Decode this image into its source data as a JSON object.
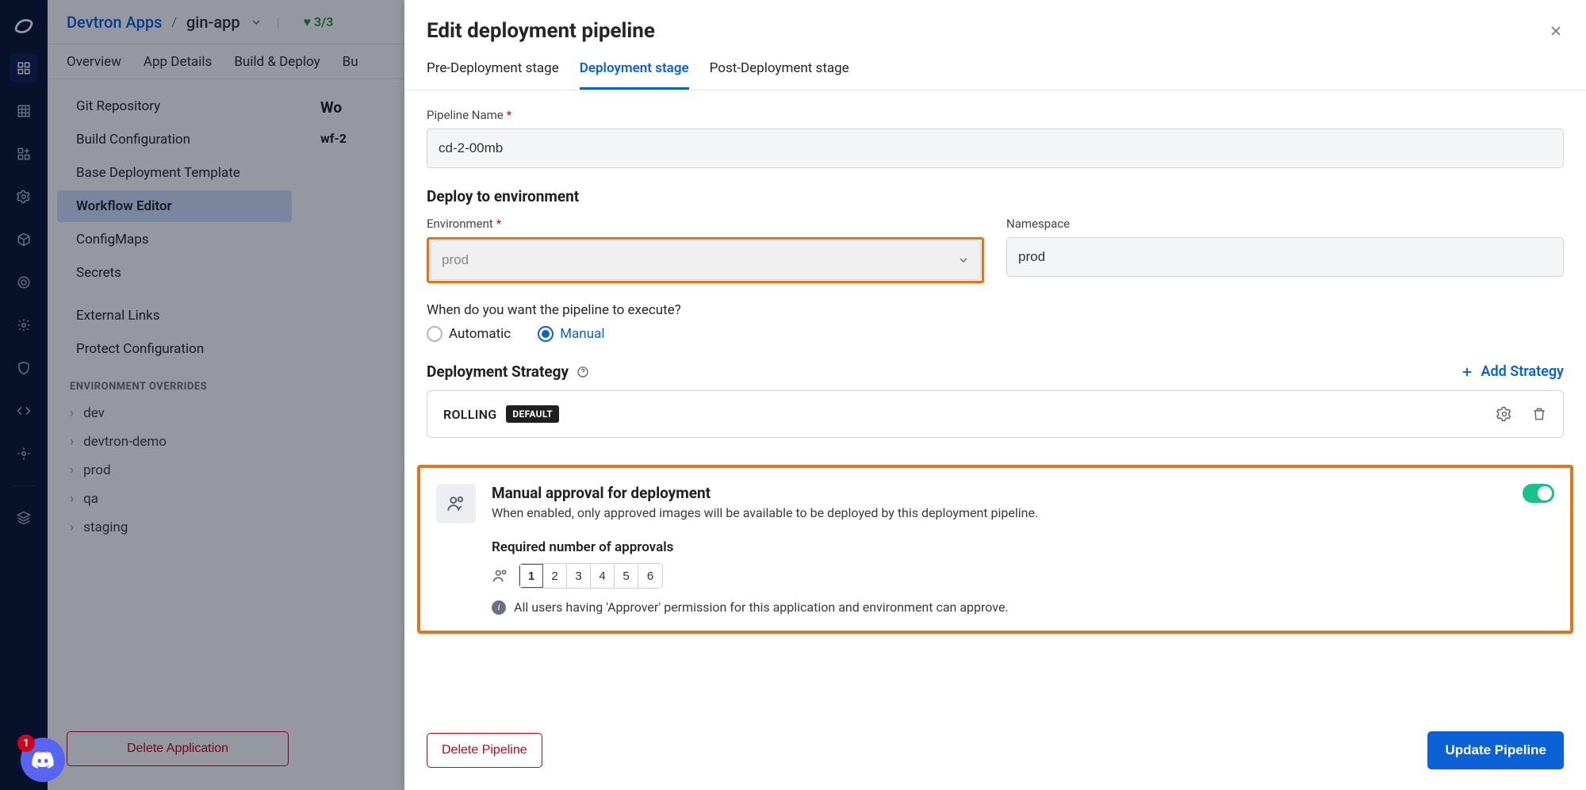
{
  "breadcrumb": {
    "root": "Devtron Apps",
    "app": "gin-app",
    "status": "3/3"
  },
  "top_tabs": [
    "Overview",
    "App Details",
    "Build & Deploy",
    "Bu"
  ],
  "sidepanel": {
    "items": [
      "Git Repository",
      "Build Configuration",
      "Base Deployment Template",
      "Workflow Editor",
      "ConfigMaps",
      "Secrets",
      "External Links",
      "Protect Configuration"
    ],
    "selected": "Workflow Editor",
    "env_heading": "ENVIRONMENT OVERRIDES",
    "envs": [
      "dev",
      "devtron-demo",
      "prod",
      "qa",
      "staging"
    ]
  },
  "main": {
    "workflows_heading": "Wo",
    "wf_name": "wf-2"
  },
  "delete_app_label": "Delete Application",
  "discord_badge": "1",
  "drawer": {
    "title": "Edit deployment pipeline",
    "tabs": [
      "Pre-Deployment stage",
      "Deployment stage",
      "Post-Deployment stage"
    ],
    "active_tab": "Deployment stage",
    "pipeline_name_label": "Pipeline Name",
    "pipeline_name": "cd-2-00mb",
    "deploy_to_env": "Deploy to environment",
    "env_label": "Environment",
    "env_value": "prod",
    "namespace_label": "Namespace",
    "namespace_value": "prod",
    "exec_question": "When do you want the pipeline to execute?",
    "exec_options": {
      "automatic": "Automatic",
      "manual": "Manual"
    },
    "strategy_label": "Deployment Strategy",
    "add_strategy": "Add Strategy",
    "strategy_item": {
      "name": "ROLLING",
      "default_badge": "DEFAULT"
    },
    "approval": {
      "title": "Manual approval for deployment",
      "desc": "When enabled, only approved images will be available to be deployed by this deployment pipeline.",
      "count_label": "Required number of approvals",
      "options": [
        "1",
        "2",
        "3",
        "4",
        "5",
        "6"
      ],
      "selected": "1",
      "note": "All users having 'Approver' permission for this application and environment can approve."
    },
    "footer": {
      "delete": "Delete Pipeline",
      "update": "Update Pipeline"
    }
  }
}
